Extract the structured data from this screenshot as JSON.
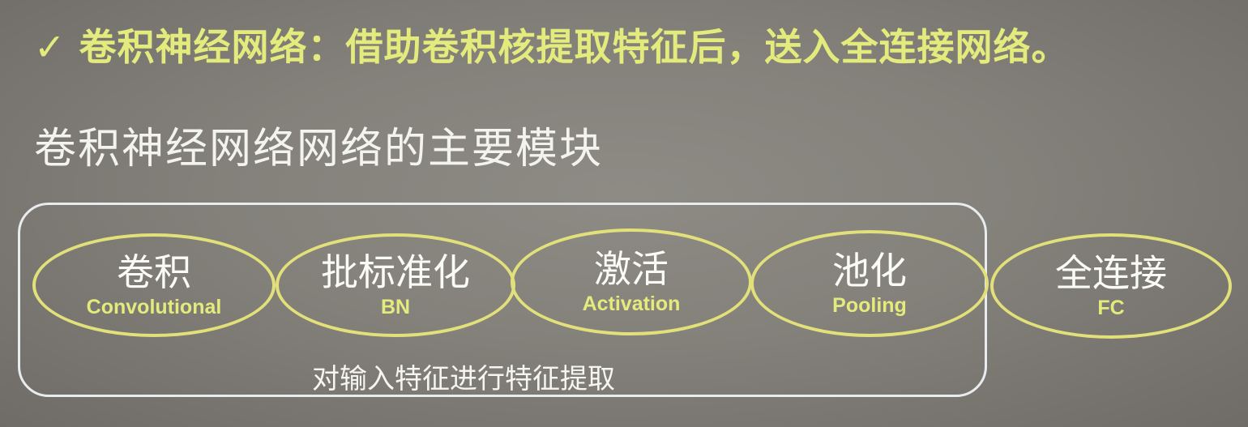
{
  "bullet": {
    "icon": "checkmark-icon",
    "check_glyph": "✓",
    "text": "卷积神经网络：借助卷积核提取特征后，送入全连接网络。"
  },
  "subtitle": "卷积神经网络网络的主要模块",
  "feature_group": {
    "caption": "对输入特征进行特征提取"
  },
  "modules": [
    {
      "zh": "卷积",
      "en": "Convolutional"
    },
    {
      "zh": "批标准化",
      "en": "BN"
    },
    {
      "zh": "激活",
      "en": "Activation"
    },
    {
      "zh": "池化",
      "en": "Pooling"
    },
    {
      "zh": "全连接",
      "en": "FC"
    }
  ],
  "colors": {
    "background": "#84817b",
    "accent_yellow": "#e3eb7c",
    "ellipse_border": "#e2e07a",
    "frame_border": "#e8ecef",
    "text_white": "#fbfbf6"
  }
}
